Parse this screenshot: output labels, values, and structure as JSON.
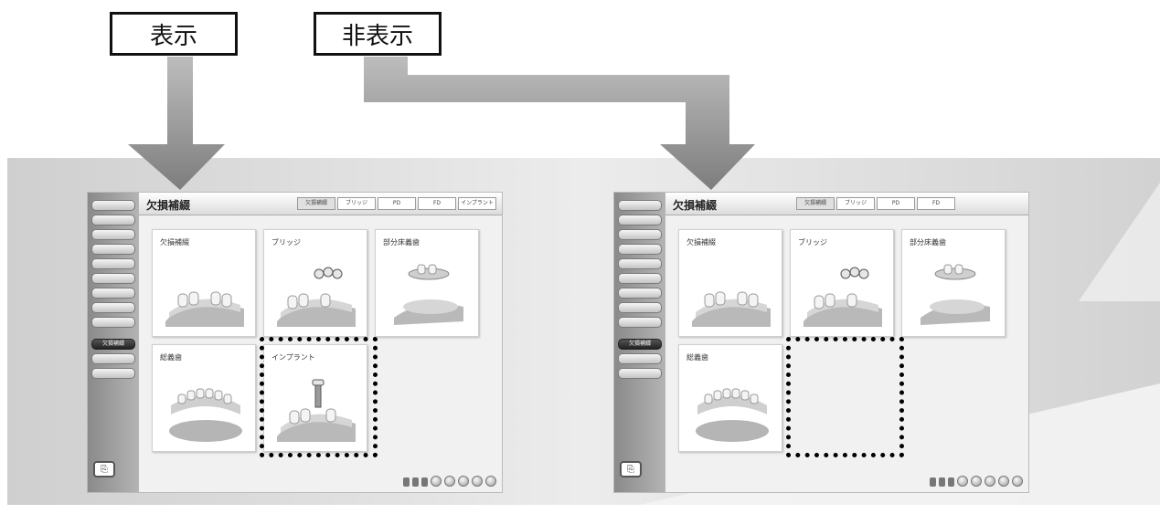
{
  "labels": {
    "show": "表示",
    "hide": "非表示"
  },
  "screens": [
    {
      "side_items": [
        "",
        "",
        "",
        "",
        "",
        "",
        "",
        "",
        "",
        "欠損補綴",
        "",
        ""
      ],
      "active_index": 9,
      "header_title": "欠損補綴",
      "tabs": [
        "欠損補綴",
        "ブリッジ",
        "PD",
        "FD",
        "インプラント"
      ],
      "cards": [
        "欠損補綴",
        "ブリッジ",
        "部分床義歯",
        "総義歯",
        "インプラント"
      ]
    },
    {
      "side_items": [
        "",
        "",
        "",
        "",
        "",
        "",
        "",
        "",
        "",
        "欠損補綴",
        "",
        ""
      ],
      "active_index": 9,
      "header_title": "欠損補綴",
      "tabs": [
        "欠損補綴",
        "ブリッジ",
        "PD",
        "FD"
      ],
      "cards": [
        "欠損補綴",
        "ブリッジ",
        "部分床義歯",
        "総義歯"
      ]
    }
  ],
  "colors": {
    "arrow": "#9a9a9a",
    "band": "#d4d4d4"
  },
  "icons": {
    "home": "home-icon",
    "tooth": "tooth-icon",
    "circle": "circle-button-icon"
  }
}
